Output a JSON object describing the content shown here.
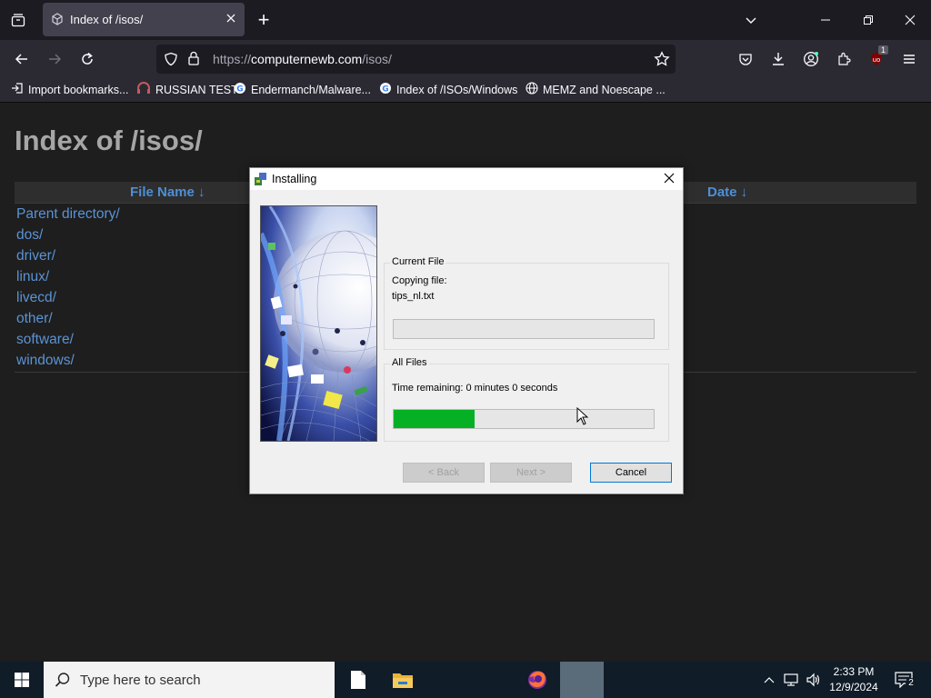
{
  "browser": {
    "tab_title": "Index of /isos/",
    "new_tab_glyph": "+",
    "url_prefix": "https://",
    "url_domain": "computernewb.com",
    "url_path": "/isos/",
    "extension_badge": "1",
    "bookmarks": [
      {
        "label": "Import bookmarks...",
        "icon": "import-icon"
      },
      {
        "label": "RUSSIAN TEST",
        "icon": "headset-icon"
      },
      {
        "label": "Endermanch/Malware...",
        "icon": "google-icon"
      },
      {
        "label": "Index of /ISOs/Windows",
        "icon": "google-icon"
      },
      {
        "label": "MEMZ and Noescape ...",
        "icon": "globe-icon"
      }
    ]
  },
  "page": {
    "heading": "Index of /isos/",
    "col_filename": "File Name  ↓",
    "col_date": "Date  ↓",
    "entries": [
      "Parent directory/",
      "dos/",
      "driver/",
      "linux/",
      "livecd/",
      "other/",
      "software/",
      "windows/"
    ]
  },
  "dialog": {
    "title": "Installing",
    "current_file_legend": "Current File",
    "copying_label": "Copying file:",
    "file_name": "tips_nl.txt",
    "current_progress": 0,
    "all_files_legend": "All Files",
    "time_remaining": "Time remaining: 0 minutes 0 seconds",
    "all_progress": 0.31,
    "back_label": "< Back",
    "next_label": "Next >",
    "cancel_label": "Cancel"
  },
  "taskbar": {
    "search_placeholder": "Type here to search",
    "time": "2:33 PM",
    "date": "12/9/2024",
    "notification_count": "2"
  },
  "colors": {
    "progress_fill": "#06b025",
    "link": "#5b93d4",
    "header_link": "#4e8fd6"
  }
}
